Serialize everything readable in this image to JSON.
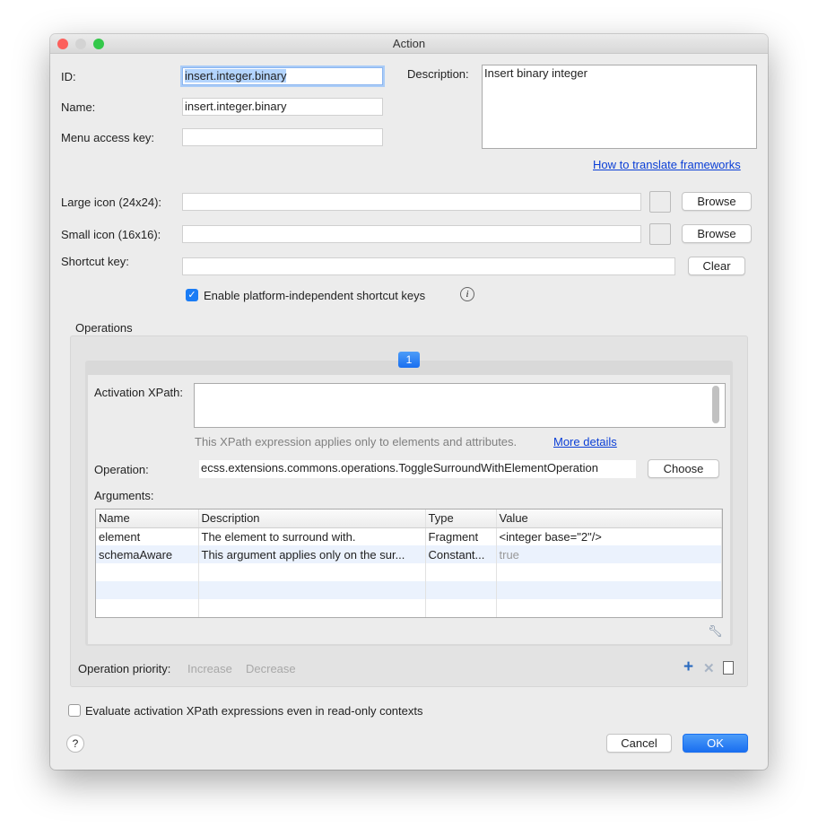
{
  "window": {
    "title": "Action"
  },
  "form": {
    "id_label": "ID:",
    "id_value": "insert.integer.binary",
    "name_label": "Name:",
    "name_value": "insert.integer.binary",
    "menu_key_label": "Menu access key:",
    "menu_key_value": "",
    "description_label": "Description:",
    "description_value": "Insert binary integer",
    "translate_link": "How to translate frameworks",
    "large_icon_label": "Large icon (24x24):",
    "large_icon_value": "",
    "small_icon_label": "Small icon (16x16):",
    "small_icon_value": "",
    "browse_label": "Browse",
    "shortcut_label": "Shortcut key:",
    "shortcut_value": "",
    "clear_label": "Clear",
    "platform_checkbox_label": "Enable platform-independent shortcut keys",
    "platform_checked": true
  },
  "operations": {
    "title": "Operations",
    "tab": "1",
    "xpath_label": "Activation XPath:",
    "xpath_value": "",
    "xpath_hint": "This XPath expression applies only to elements and attributes.",
    "more_details": "More details",
    "operation_label": "Operation:",
    "operation_value": "ecss.extensions.commons.operations.ToggleSurroundWithElementOperation",
    "choose_label": "Choose",
    "arguments_label": "Arguments:",
    "columns": [
      "Name",
      "Description",
      "Type",
      "Value"
    ],
    "rows": [
      [
        "element",
        "The element to surround with.",
        "Fragment",
        "<integer base=\"2\"/>"
      ],
      [
        "schemaAware",
        "This argument applies only on the sur...",
        "Constant...",
        "true"
      ]
    ],
    "priority_label": "Operation priority:",
    "increase": "Increase",
    "decrease": "Decrease"
  },
  "footer": {
    "readonly_label": "Evaluate activation XPath expressions even in read-only contexts",
    "readonly_checked": false,
    "help": "?",
    "cancel": "Cancel",
    "ok": "OK"
  },
  "colors": {
    "accent": "#1a7cf5",
    "selection": "#b3d4fd",
    "link": "#0b3fd6"
  }
}
